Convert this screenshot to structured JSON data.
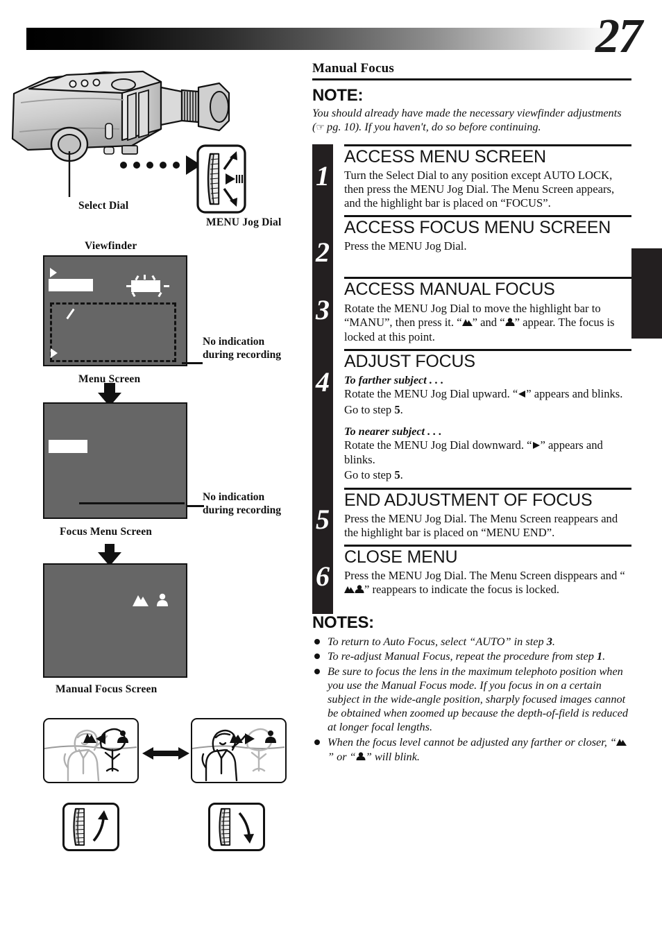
{
  "header": {
    "page_number": "27",
    "gradient_from": "#000000",
    "gradient_to": "#ffffff"
  },
  "left_column": {
    "camcorder_figure": {
      "select_dial_label": "Select Dial",
      "menu_jog_dial_label": "MENU Jog Dial"
    },
    "viewfinder_label": "Viewfinder",
    "screens": [
      {
        "name": "menu-screen",
        "caption": "Menu Screen",
        "side_note": "No indication during recording"
      },
      {
        "name": "focus-menu-screen",
        "caption": "Focus Menu Screen",
        "side_note": "No indication during recording"
      },
      {
        "name": "manual-focus-screen",
        "caption": "Manual Focus Screen",
        "icons": [
          "mountain-icon",
          "person-icon"
        ]
      }
    ],
    "comparison_figure": {
      "left_photo": "farther-subject-in-focus",
      "right_photo": "nearer-subject-in-focus",
      "left_jog": "jog-dial-rotate-up-icon",
      "right_jog": "jog-dial-rotate-down-icon"
    }
  },
  "right_column": {
    "section_title": "Manual Focus",
    "note_heading": "NOTE:",
    "note_text_before": "You should already have made the necessary viewfinder adjustments (",
    "note_hand_icon": "☞",
    "note_text_after": " pg. 10). If you haven't, do so before continuing.",
    "steps": [
      {
        "number": "1",
        "heading": "ACCESS MENU SCREEN",
        "body": "Turn the Select Dial to any position except AUTO LOCK, then press the MENU Jog Dial. The Menu Screen appears, and the highlight bar is placed on “FOCUS”."
      },
      {
        "number": "2",
        "heading": "ACCESS FOCUS MENU SCREEN",
        "body": "Press the MENU Jog Dial."
      },
      {
        "number": "3",
        "heading": "ACCESS MANUAL FOCUS",
        "body_1": "Rotate the MENU Jog Dial to move the highlight bar to “MANU”, then press it. “",
        "body_2": "” and “",
        "body_3": "” appear. The focus is locked at this point."
      },
      {
        "number": "4",
        "heading": "ADJUST FOCUS",
        "sub_head_1": "To farther subject . . .",
        "body_1a": "Rotate the MENU Jog Dial upward. “",
        "body_1b": "” appears and blinks.",
        "goto_1a": "Go to step ",
        "goto_1b": "5",
        "goto_1c": ".",
        "sub_head_2": "To nearer subject . . .",
        "body_2a": "Rotate the MENU Jog Dial downward. “",
        "body_2b": "” appears and blinks.",
        "goto_2a": "Go to step ",
        "goto_2b": "5",
        "goto_2c": "."
      },
      {
        "number": "5",
        "heading": "END ADJUSTMENT OF FOCUS",
        "body": "Press the MENU Jog Dial. The Menu Screen reappears and the highlight bar is placed on “MENU END”."
      },
      {
        "number": "6",
        "heading": "CLOSE MENU",
        "body_1": "Press the MENU Jog Dial. The Menu Screen disppears and “",
        "body_2": "” reappears to indicate the focus is locked."
      }
    ],
    "notes_heading": "NOTES:",
    "notes": [
      {
        "text_1": "To return to Auto Focus, select “AUTO” in step ",
        "bold": "3",
        "text_2": "."
      },
      {
        "text_1": "To re-adjust Manual Focus, repeat the procedure from step ",
        "bold": "1",
        "text_2": "."
      },
      {
        "text_1": "Be sure to focus the lens in the maximum telephoto position when you use the Manual Focus mode. If you focus in on a certain subject in the wide-angle position, sharply focused images cannot be obtained when zoomed up because the depth-of-field is reduced at longer focal lengths.",
        "bold": "",
        "text_2": ""
      }
    ],
    "last_note": {
      "text_1": "When the focus level cannot be adjusted any farther or closer, “",
      "text_2": "” or “",
      "text_3": "” will blink."
    }
  }
}
